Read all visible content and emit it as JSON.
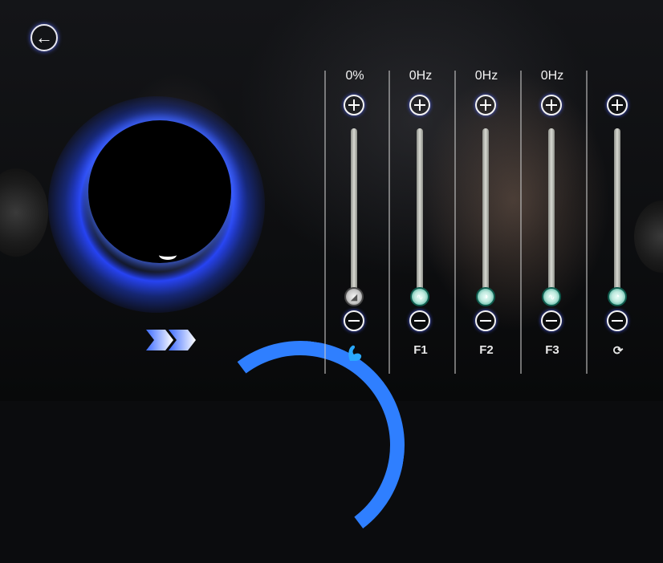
{
  "screen": {
    "back_icon": "back-arrow-icon"
  },
  "controls": {
    "columns": [
      {
        "id": "intensity",
        "value": "0%",
        "label": "",
        "label_icon": "muscle-arm-icon",
        "knob_icon": "ramp-icon",
        "level": 0
      },
      {
        "id": "f1",
        "value": "0Hz",
        "label": "F1",
        "label_icon": "",
        "knob_icon": "pulse-wave-icon",
        "level": 0
      },
      {
        "id": "f2",
        "value": "0Hz",
        "label": "F2",
        "label_icon": "",
        "knob_icon": "half-circle-icon",
        "level": 0
      },
      {
        "id": "f3",
        "value": "0Hz",
        "label": "F3",
        "label_icon": "",
        "knob_icon": "pulse-wave-icon",
        "level": 0
      },
      {
        "id": "timer",
        "value": "",
        "label": "",
        "label_icon": "timer-icon",
        "knob_icon": "pie-icon",
        "level": 0
      }
    ]
  },
  "colors": {
    "glow_blue": "#2f5fff",
    "knob_teal": "#2ea08a",
    "arc_blue": "#2f7fff"
  }
}
